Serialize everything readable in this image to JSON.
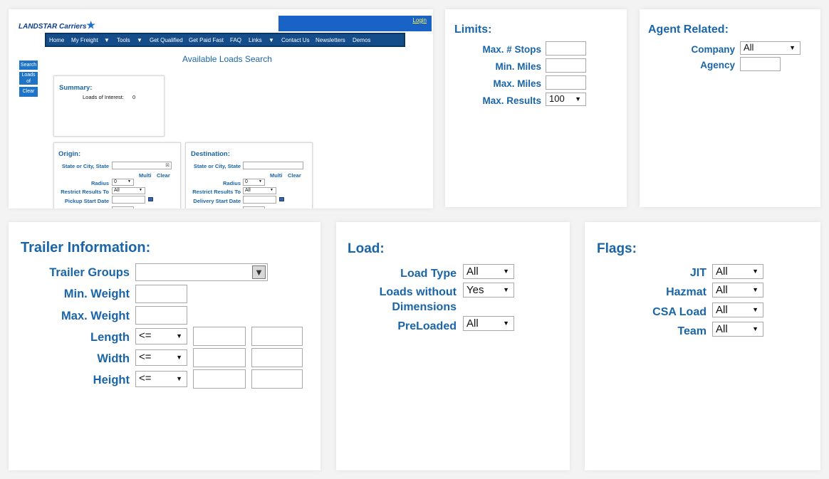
{
  "landstar": {
    "logo": "LANDSTAR Carriers",
    "login": "Login",
    "nav": [
      "Home",
      "My Freight",
      "▼",
      "Tools",
      "▼",
      "Get Qualified",
      "Get Paid Fast",
      "FAQ",
      "Links",
      "▼",
      "Contact Us",
      "Newsletters",
      "Demos"
    ],
    "side": [
      "Search",
      "Loads of",
      "Clear"
    ],
    "title": "Available Loads Search",
    "summary": {
      "heading": "Summary:",
      "label": "Loads of Interest:",
      "value": "0"
    },
    "origin": {
      "heading": "Origin:",
      "state": "State or City, State",
      "multi": "Multi",
      "clear": "Clear",
      "radius": "Radius",
      "radius_value": "0",
      "restrict": "Restrict Results To",
      "restrict_value": "All",
      "date": "Pickup Start Date"
    },
    "destination": {
      "heading": "Destination:",
      "state": "State or City, State",
      "multi": "Multi",
      "clear": "Clear",
      "radius": "Radius",
      "radius_value": "0",
      "restrict": "Restrict Results To",
      "restrict_value": "All",
      "date": "Delivery Start Date"
    }
  },
  "limits": {
    "heading": "Limits:",
    "stops": "Max. # Stops",
    "min_miles": "Min. Miles",
    "max_miles": "Max. Miles",
    "max_results": "Max. Results",
    "max_results_value": "100"
  },
  "agent": {
    "heading": "Agent Related:",
    "company": "Company",
    "company_value": "All",
    "agency": "Agency"
  },
  "trailer": {
    "heading": "Trailer Information:",
    "groups": "Trailer Groups",
    "min_weight": "Min. Weight",
    "max_weight": "Max. Weight",
    "length": "Length",
    "width": "Width",
    "height": "Height",
    "op": "<="
  },
  "load": {
    "heading": "Load:",
    "type": "Load Type",
    "type_value": "All",
    "without_1": "Loads without",
    "without_2": "Dimensions",
    "without_value": "Yes",
    "preloaded": "PreLoaded",
    "preloaded_value": "All"
  },
  "flags": {
    "heading": "Flags:",
    "jit": "JIT",
    "hazmat": "Hazmat",
    "csa": "CSA Load",
    "team": "Team",
    "value": "All"
  },
  "icons": {
    "star": "★",
    "arrow": "▼",
    "clear_box": "⊠"
  },
  "colors": {
    "label": "#1a65a8",
    "nav": "#154c8a",
    "login_bar": "#1a63c6",
    "side": "#1e75c8"
  }
}
